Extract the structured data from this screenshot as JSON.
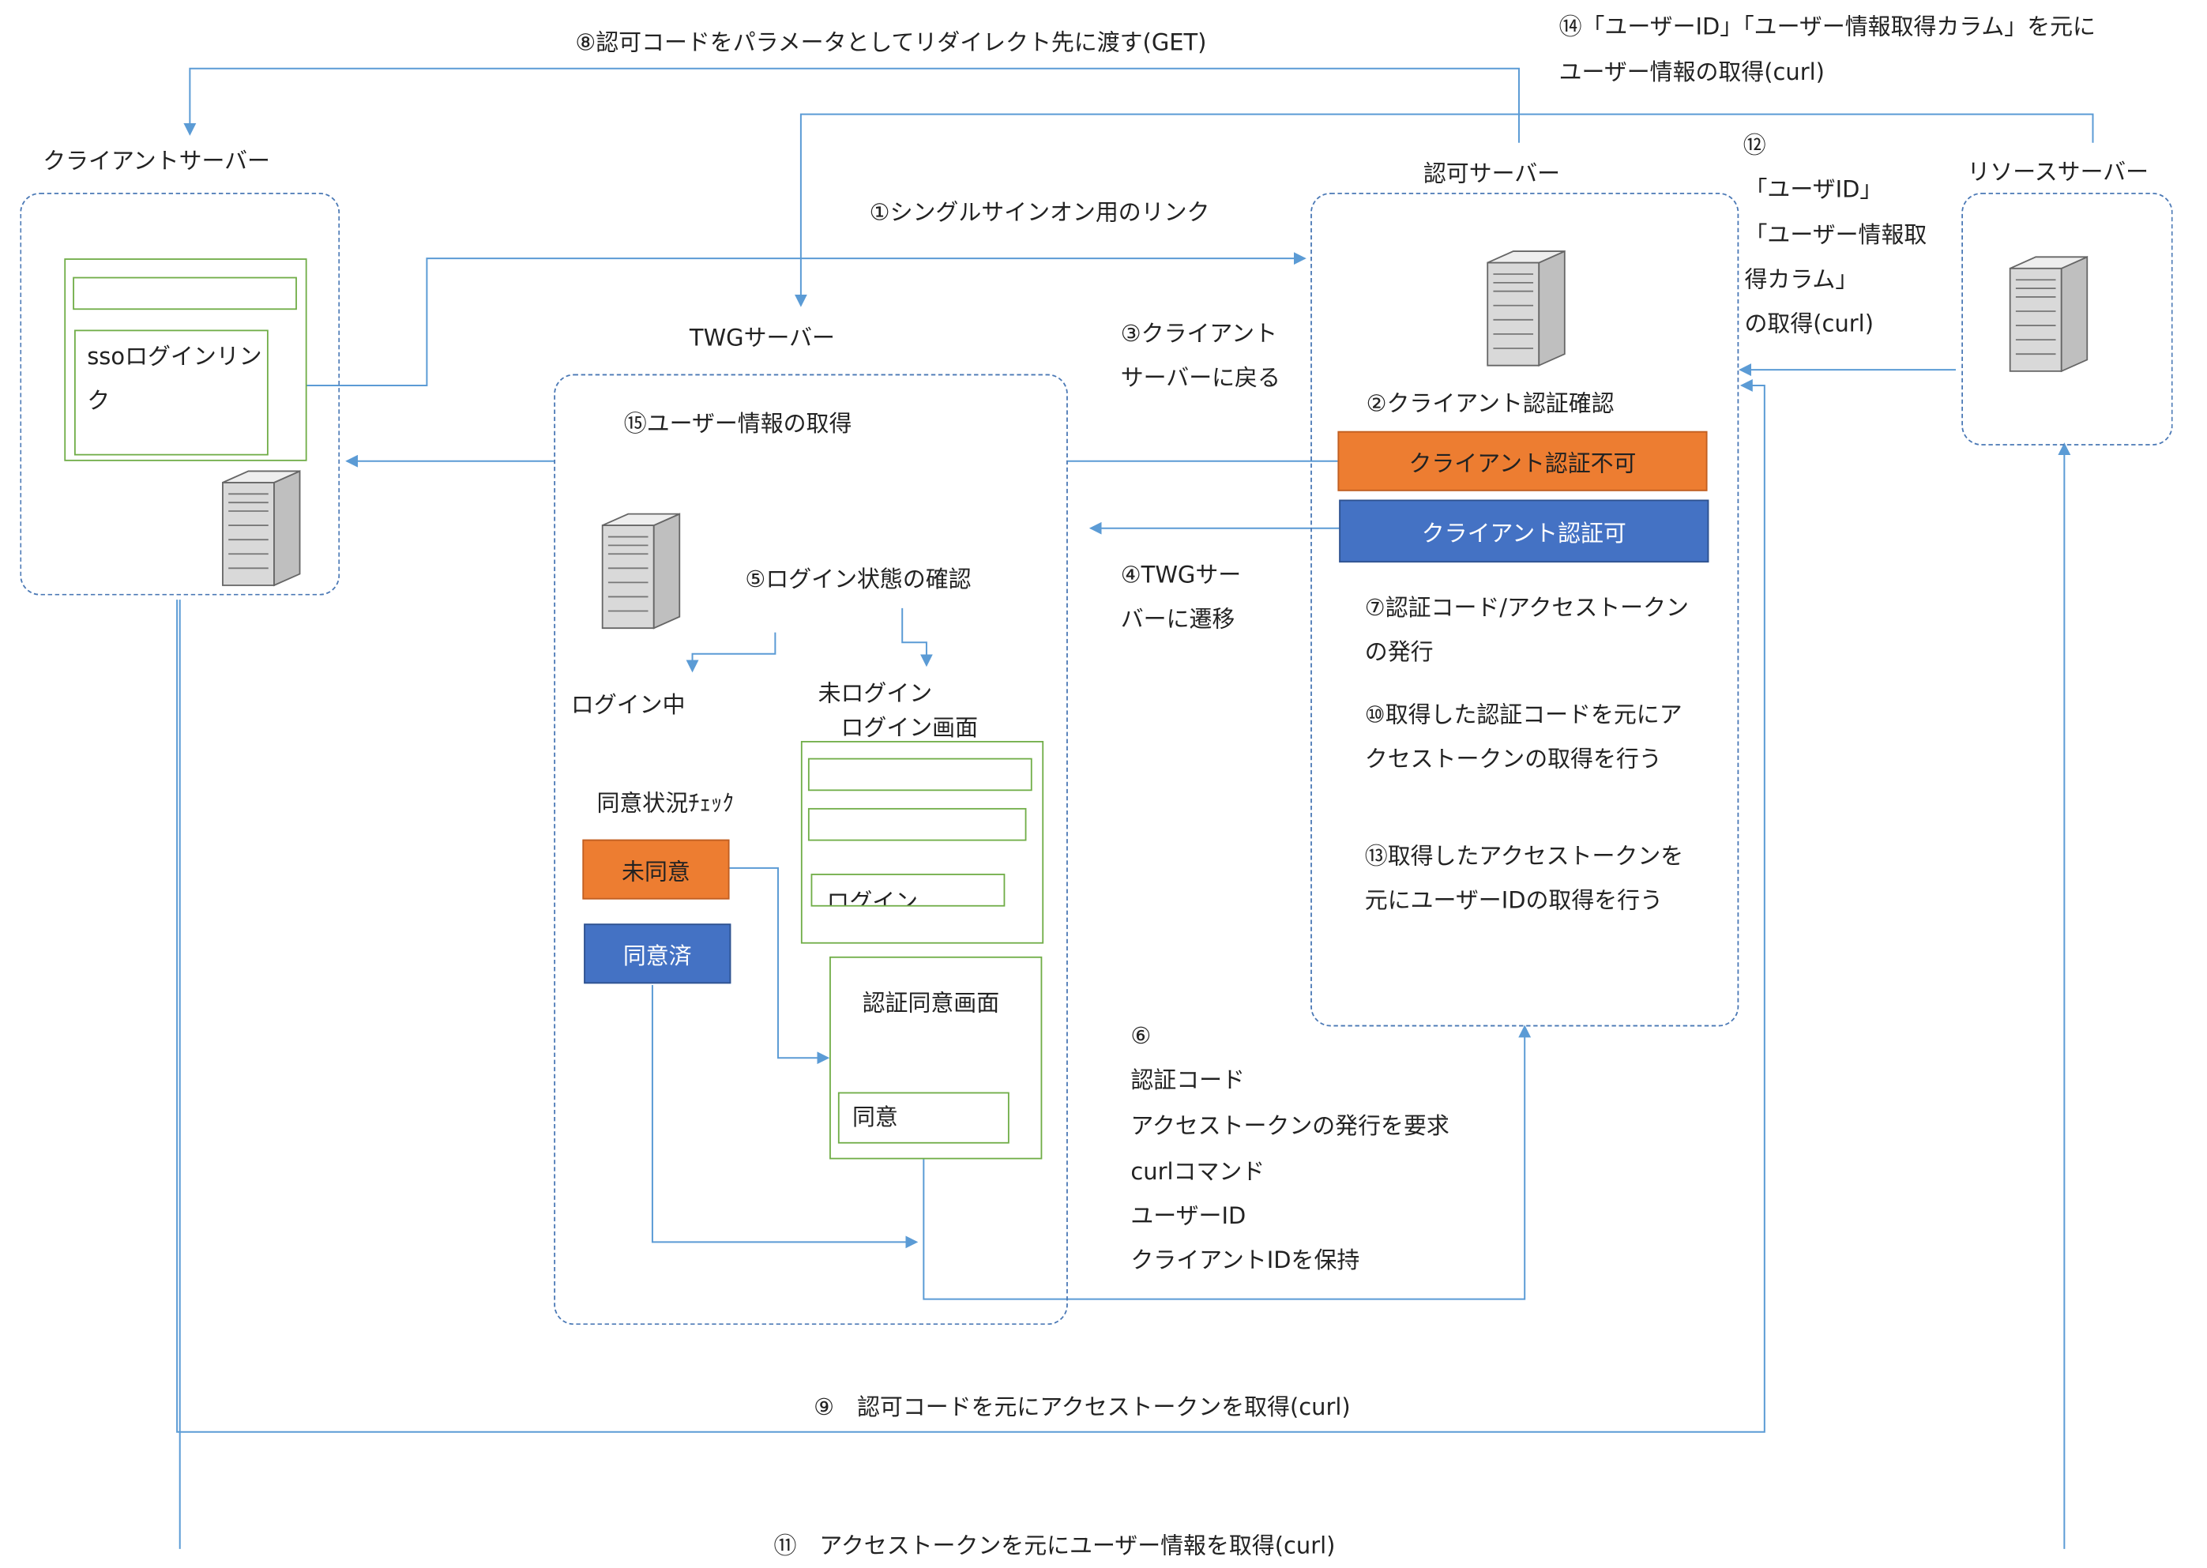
{
  "servers": {
    "client": "クライアントサーバー",
    "twg": "TWGサーバー",
    "auth": "認可サーバー",
    "resource": "リソースサーバー"
  },
  "client_ui": {
    "sso_link": "ssoログインリンク"
  },
  "twg": {
    "step15": "⑮ユーザー情報の取得",
    "step5": "⑤ログイン状態の確認",
    "logged_in": "ログイン中",
    "not_logged_in": "未ログイン",
    "login_screen": "ログイン画面",
    "login_button": "ログイン",
    "consent_check": "同意状況ﾁｪｯｸ",
    "not_consented": "未同意",
    "consented": "同意済",
    "consent_screen": "認証同意画面",
    "agree_button": "同意"
  },
  "auth": {
    "step2": "②クライアント認証確認",
    "unauthorized": "クライアント認証不可",
    "authorized": "クライアント認証可",
    "step7": "⑦認証コード/アクセストークンの発行",
    "step10": "⑩取得した認証コードを元にアクセストークンの取得を行う",
    "step13": "⑬取得したアクセストークンを元にユーザーIDの取得を行う"
  },
  "arrows": {
    "step1": "①シングルサインオン用のリンク",
    "step3": "③クライアントサーバーに戻る",
    "step4": "④TWGサーバーに遷移",
    "step6_num": "⑥",
    "step6_lines": [
      "認証コード",
      "アクセストークンの発行を要求",
      "curlコマンド",
      "ユーザーID",
      "クライアントIDを保持"
    ],
    "step8": "⑧認可コードをパラメータとしてリダイレクト先に渡す(GET)",
    "step9": "⑨　認可コードを元にアクセストークンを取得(curl)",
    "step11": "⑪　アクセストークンを元にユーザー情報を取得(curl)",
    "step12_num": "⑫",
    "step12_lines": [
      "「ユーザID」",
      "「ユーザー情報取",
      "得カラム」",
      "の取得(curl)"
    ],
    "step14_lines": [
      "⑭「ユーザーID」「ユーザー情報取得カラム」を元に",
      "ユーザー情報の取得(curl)"
    ]
  },
  "colors": {
    "line": "#5b9bd5",
    "green": "#70ad47",
    "orange": "#ed7d31",
    "blue": "#4472c4"
  }
}
